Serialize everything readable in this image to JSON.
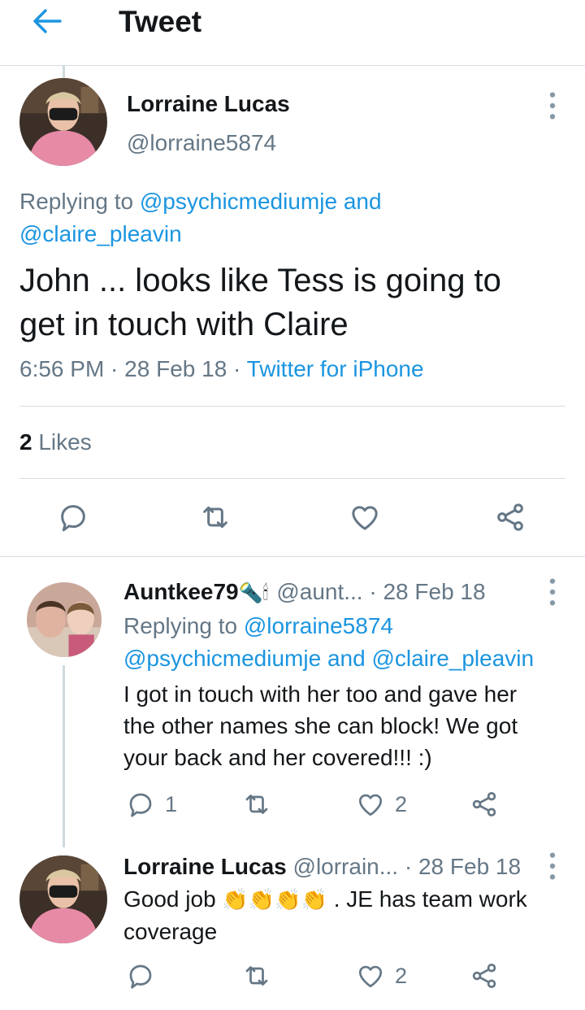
{
  "header": {
    "title": "Tweet"
  },
  "main_tweet": {
    "author_name": "Lorraine Lucas",
    "author_handle": "@lorraine5874",
    "replying_prefix": "Replying to ",
    "replying_user1": "@psychicmediumje",
    "replying_and": " and",
    "replying_user2": "@claire_pleavin",
    "text_line1": "John ... looks like Tess is going to",
    "text_line2": "get in touch with Claire",
    "time": "6:56 PM",
    "sep1": " · ",
    "date": "28 Feb 18",
    "sep2": " · ",
    "source": "Twitter for iPhone",
    "likes_count": "2",
    "likes_label": " Likes"
  },
  "reply1": {
    "author_name": "Auntkee79",
    "emoji": "🔦🕯",
    "handle": "@aunt...",
    "date": " · 28 Feb 18",
    "replying_prefix": "Replying to ",
    "replying_user1": "@lorraine5874",
    "replying_user2": "@psychicmediumje",
    "replying_and": " and ",
    "replying_user3": "@claire_pleavin",
    "text_line1": "I got in touch with her too and gave her",
    "text_line2": "the other names she can block! We got",
    "text_line3": "your back and her covered!!! :)",
    "reply_count": "1",
    "like_count": "2"
  },
  "reply2": {
    "author_name": "Lorraine Lucas",
    "handle": " @lorrain...",
    "date": " · 28 Feb 18",
    "text_start": "Good job ",
    "emoji": "👏👏👏👏",
    "text_end": " .  JE has team work",
    "text_line2": "coverage",
    "like_count": "2"
  },
  "colors": {
    "accent": "#1b95e0",
    "secondary_text": "#657786",
    "divider": "#d6dde3"
  }
}
